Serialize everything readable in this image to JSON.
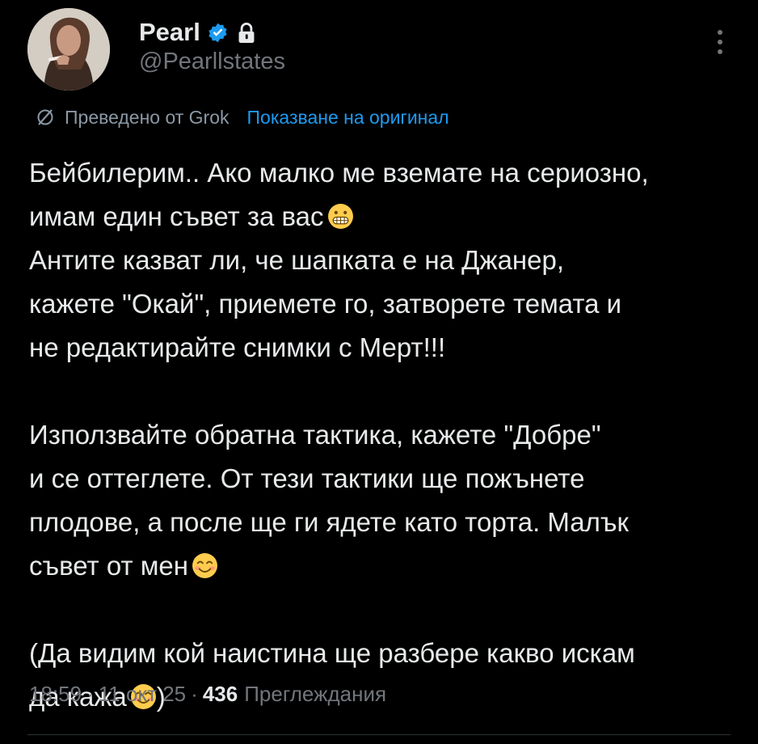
{
  "author": {
    "name": "Pearl",
    "handle": "@Pearllstates"
  },
  "translation": {
    "translated_by": "Преведено от Grok",
    "show_original": "Показване на оригинал"
  },
  "post": {
    "lines_p1": [
      "Бейбилерим.. Ако малко ме вземате на сериозно,",
      "имам един съвет за вас",
      "Антите казват ли, че шапката е на Джанер,",
      "кажете \"Окай\", приемете го, затворете темата и",
      "не редактирайте снимки с Мерт!!!"
    ],
    "lines_p2": [
      "Използвайте обратна тактика, кажете \"Добре\"",
      "и се оттеглете. От тези тактики ще пожънете",
      "плодове, а после ще ги ядете като торта. Малък",
      "съвет от мен"
    ],
    "lines_p3": [
      "(Да видим кой наистина ще разбере какво искам",
      "да кажа",
      ")"
    ]
  },
  "meta": {
    "time": "18:59",
    "date": "11 окт 25",
    "views_count": "436",
    "views_label": "Преглеждания"
  },
  "colors": {
    "background": "#000000",
    "text": "#e7e9ea",
    "secondary": "#71767b",
    "link": "#1d9bf0",
    "verified": "#1d9bf0"
  }
}
